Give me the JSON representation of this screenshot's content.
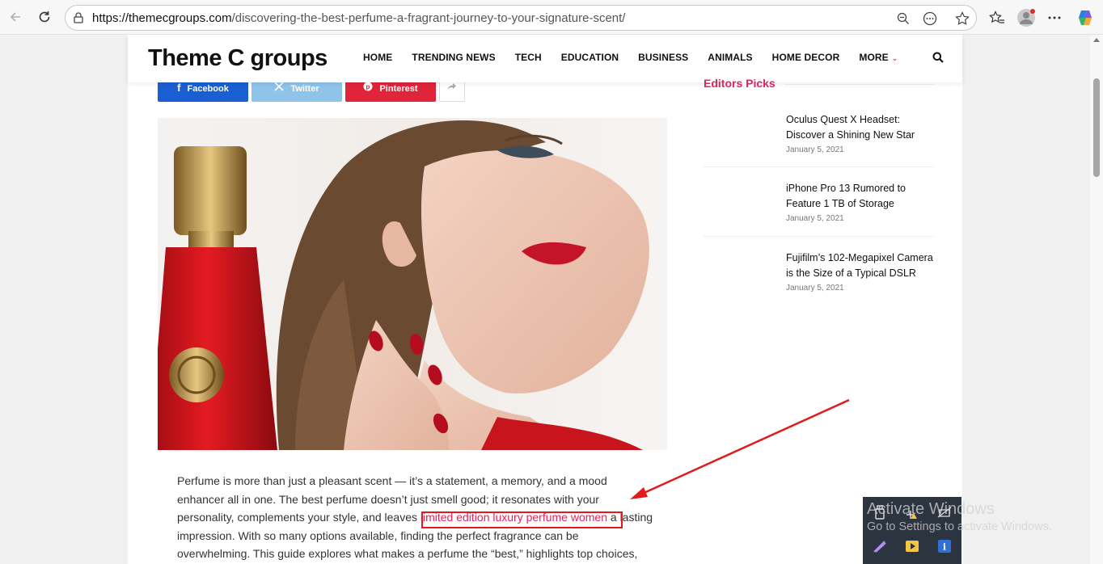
{
  "browser": {
    "url_domain": "https://themecgroups.com",
    "url_path": "/discovering-the-best-perfume-a-fragrant-journey-to-your-signature-scent/"
  },
  "site": {
    "logo": "Theme C groups",
    "nav": [
      "HOME",
      "TRENDING NEWS",
      "TECH",
      "EDUCATION",
      "BUSINESS",
      "ANIMALS",
      "HOME DECOR",
      "MORE"
    ]
  },
  "share": {
    "facebook": "Facebook",
    "twitter": "Twitter",
    "pinterest": "Pinterest"
  },
  "article": {
    "text_before_link": "Perfume is more than just a pleasant scent — it’s a statement, a memory, and a mood enhancer all in one. The best perfume doesn’t just smell good; it resonates with your personality, complements your style, and leaves",
    "link_text": " limited edition luxury perfume women",
    "text_after_link": " a lasting impression. With so many options available, finding the perfect fragrance can be overwhelming. This guide explores what makes a perfume the “best,” highlights top choices,"
  },
  "sidebar": {
    "heading": "Editors Picks",
    "items": [
      {
        "title": "Oculus Quest X Headset: Discover a Shining New Star",
        "date": "January 5, 2021"
      },
      {
        "title": "iPhone Pro 13 Rumored to Feature 1 TB of Storage",
        "date": "January 5, 2021"
      },
      {
        "title": "Fujifilm’s 102-Megapixel Camera is the Size of a Typical DSLR",
        "date": "January 5, 2021"
      }
    ]
  },
  "windows": {
    "activate_title": "Activate Windows",
    "activate_sub": "Go to Settings to activate Windows."
  },
  "colors": {
    "accent": "#e0245e",
    "facebook": "#1a5fd1",
    "twitter": "#8fc3ea",
    "pinterest": "#e0243a",
    "annotation": "#e11b1b"
  }
}
